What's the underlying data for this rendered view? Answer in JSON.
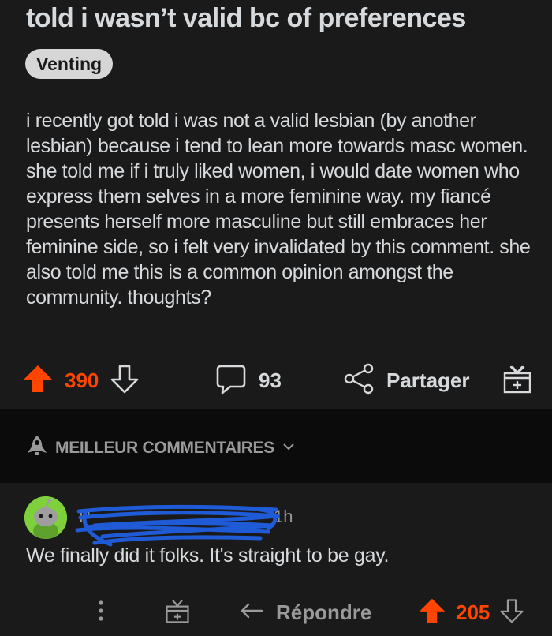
{
  "post": {
    "title": "told i wasn’t valid bc of preferences",
    "flair": "Venting",
    "body": "i recently got told i was not a valid lesbian (by another lesbian) because i tend to lean more towards masc women. she told me if i truly liked women, i would date women who express them selves in a more feminine way. my fiancé presents herself more masculine but still embraces her feminine side, so i felt very invalidated by this comment. she also told me this is a common opinion amongst the community. thoughts?",
    "votes": "390",
    "comments": "93",
    "share_label": "Partager"
  },
  "sort": {
    "label": "MEILLEUR COMMENTAIRES"
  },
  "comment": {
    "username": "P",
    "time": "1h",
    "text": "We finally did it folks. It's straight to be gay.",
    "reply_label": "Répondre",
    "votes": "205"
  },
  "colors": {
    "upvote": "#ff4500",
    "background": "#1a1a1b",
    "sortbar": "#0b0b0b",
    "avatar": "#7fd13b",
    "redaction": "#1f5bd6"
  },
  "icons": {
    "upvote": "upvote-arrow-icon",
    "downvote": "downvote-arrow-icon",
    "comments": "speech-bubble-icon",
    "share": "share-nodes-icon",
    "award": "gift-icon",
    "sort": "rocket-icon",
    "more": "vertical-dots-icon",
    "reply": "reply-arrow-icon"
  }
}
